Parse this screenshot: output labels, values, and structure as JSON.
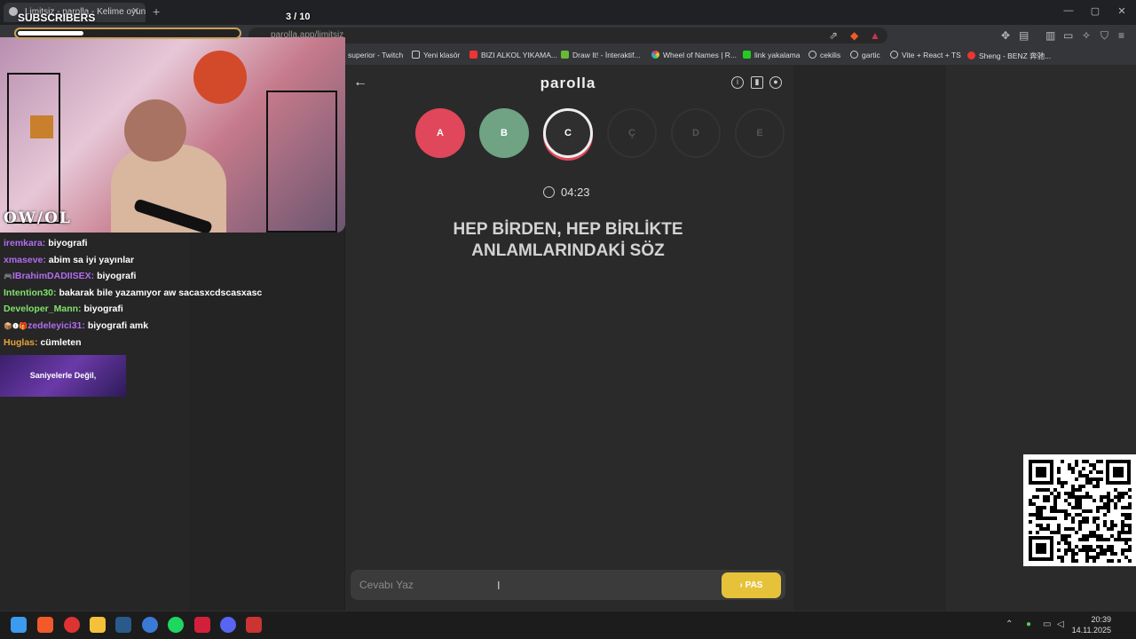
{
  "browser": {
    "tab_title": "Limitsiz - parolla - Kelime oyunu",
    "url": "parolla.app/limitsiz",
    "new_tab": "+",
    "window_controls": [
      "—",
      "▢",
      "✕"
    ],
    "bookmarks": [
      {
        "label": "superior - Twitch",
        "icon": "twitch-icon"
      },
      {
        "label": "Yeni klasör",
        "icon": "folder-icon"
      },
      {
        "label": "BIZI ALKOL YIKAMA...",
        "icon": "youtube-icon"
      },
      {
        "label": "Draw It! - İnteraktif...",
        "icon": "draw-icon"
      },
      {
        "label": "Wheel of Names | R...",
        "icon": "wheel-icon"
      },
      {
        "label": "link yakalama",
        "icon": "link-icon"
      },
      {
        "label": "cekilis",
        "icon": "globe-icon"
      },
      {
        "label": "gartic",
        "icon": "globe-icon"
      },
      {
        "label": "Vite + React + TS",
        "icon": "globe-icon"
      },
      {
        "label": "Sheng - BENZ 奔驰...",
        "icon": "youtube-icon"
      }
    ]
  },
  "stream": {
    "subscribers_label": "SUBSCRIBERS",
    "subscribers_count": "3  / 10",
    "subscribers_progress": 0.3,
    "logo_text": "OW/OL",
    "chat": [
      {
        "user": "iremkara",
        "color": "#b26cf0",
        "message": "biyografi",
        "badge": ""
      },
      {
        "user": "xmaseve",
        "color": "#b26cf0",
        "message": "abim sa iyi yayınlar",
        "badge": ""
      },
      {
        "user": "IBrahimDADIISEX",
        "color": "#b26cf0",
        "message": "biyografi",
        "badge": "🎮"
      },
      {
        "user": "Intention30",
        "color": "#7fe36a",
        "message": "bakarak bile yazamıyor aw sacasxcdscasxasc",
        "badge": ""
      },
      {
        "user": "Developer_Mann",
        "color": "#7fe36a",
        "message": "biyografi",
        "badge": ""
      },
      {
        "user": "zedeleyici31",
        "color": "#b26cf0",
        "message": "biyografi amk",
        "badge": "📦❶🎁"
      },
      {
        "user": "Huglas",
        "color": "#e8a23a",
        "message": "cümleten",
        "badge": ""
      }
    ],
    "promo_text": "Saniyelerle Değil,"
  },
  "game": {
    "title": "parolla",
    "letters": [
      {
        "letter": "A",
        "state": "wrong",
        "color": "#e0475a"
      },
      {
        "letter": "B",
        "state": "correct",
        "color": "#6fa383"
      },
      {
        "letter": "C",
        "state": "active",
        "color": "#2f2f2f"
      },
      {
        "letter": "Ç",
        "state": "pending",
        "color": "#2a2a2a"
      },
      {
        "letter": "D",
        "state": "pending",
        "color": "#2a2a2a"
      },
      {
        "letter": "E",
        "state": "pending",
        "color": "#2a2a2a"
      }
    ],
    "timer": "04:23",
    "question": "HEP BİRDEN, HEP BİRLİKTE ANLAMLARINDAKİ SÖZ",
    "answer_placeholder": "Cevabı Yaz",
    "pass_button": "PAS",
    "accent_color": "#e6c23a"
  },
  "taskbar": {
    "time": "20:39",
    "date": "14.11.2025"
  }
}
